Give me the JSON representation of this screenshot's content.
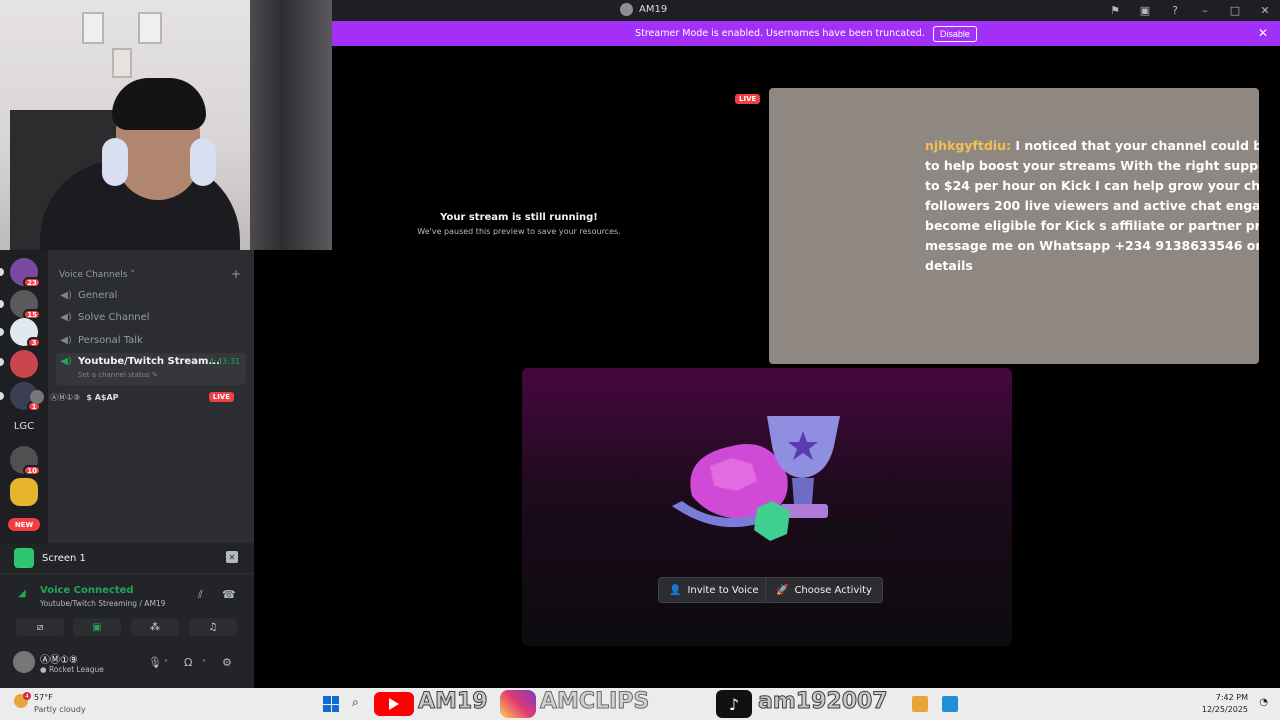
{
  "window": {
    "title": "AM19",
    "icons": [
      "flag-icon",
      "inbox-icon",
      "help-icon",
      "minimize-icon",
      "maximize-icon",
      "close-icon"
    ]
  },
  "banner": {
    "text": "Streamer Mode is enabled. Usernames have been truncated.",
    "button": "Disable",
    "color": "#a230f7"
  },
  "servers": {
    "badges": [
      "23",
      "15",
      "3",
      "1",
      "10"
    ],
    "label": "LGC",
    "new_label": "NEW"
  },
  "channels": {
    "category": "Voice Channels",
    "items": [
      {
        "name": "General"
      },
      {
        "name": "Solve Channel"
      },
      {
        "name": "Personal Talk"
      },
      {
        "name": "Youtube/Twitch Stream...",
        "timer": "4:43:31",
        "status": "Set a channel status"
      }
    ],
    "voice_user": {
      "name": "ⒶⓂ①⑨",
      "tag": "$ A$AP",
      "live": "LIVE"
    }
  },
  "screen_panel": {
    "label": "Screen 1"
  },
  "voice_panel": {
    "status": "Voice Connected",
    "location": "Youtube/Twitch Streaming / AM19"
  },
  "user_panel": {
    "name": "ⒶⓂ①⑨",
    "game": "Rocket League"
  },
  "stream": {
    "title": "Your stream is still running!",
    "subtitle": "We've paused this preview to save your resources.",
    "live": "LIVE"
  },
  "chat": {
    "user": "njhkgyftdiu",
    "message": "I noticed that your channel could benefit\nto help boost your streams With the right support, you\nto $24 per hour on Kick I can help grow your channel b\nfollowers 200 live viewers and active chat engagement\nbecome eligible for Kick s affiliate or partner program\nmessage me on Whatsapp +234 9138633546 or Discord\ndetails"
  },
  "activity": {
    "invite": "Invite to Voice",
    "choose": "Choose Activity"
  },
  "taskbar": {
    "weather_temp": "57°F",
    "weather_cond": "Partly cloudy",
    "weather_badge": "4",
    "overlay_youtube": "AM19",
    "overlay_instagram": "AMCLIPS",
    "overlay_tiktok": "am192007",
    "time": "7:42 PM",
    "date": "12/25/2025"
  }
}
